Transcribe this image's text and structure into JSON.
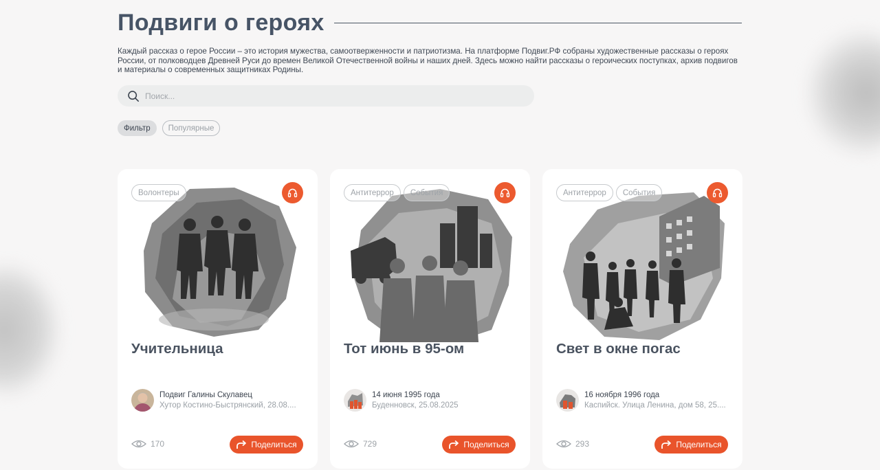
{
  "page": {
    "title": "Подвиги о героях",
    "intro": "Каждый рассказ о герое России – это история мужества, самоотверженности и патриотизма. На платформе Подвиг.РФ собраны художественные рассказы о героях России, от полководцев Древней Руси до времен Великой Отечественной войны и наших дней. Здесь можно найти рассказы о героических поступках, архив подвигов и материалы о современных защитниках Родины."
  },
  "search": {
    "placeholder": "Поиск...",
    "icon": "search-icon"
  },
  "filters": {
    "filter_label": "Фильтр",
    "popular_label": "Популярные"
  },
  "colors": {
    "accent": "#ec5a2f",
    "title": "#475466",
    "background": "#f7f6f6"
  },
  "cards": [
    {
      "tags": [
        "Волонтеры"
      ],
      "title": "Учительница",
      "meta_top": "Подвиг Галины Скулавец",
      "meta_bottom": "Хутор Костино-Быстрянский, 28.08....",
      "views": "170",
      "share_label": "Поделиться",
      "audio_icon": "headphones-icon"
    },
    {
      "tags": [
        "Антитеррор",
        "События"
      ],
      "title": "Тот июнь в 95-ом",
      "meta_top": "14 июня 1995 года",
      "meta_bottom": "Буденновск, 25.08.2025",
      "views": "729",
      "share_label": "Поделиться",
      "audio_icon": "headphones-icon"
    },
    {
      "tags": [
        "Антитеррор",
        "События"
      ],
      "title": "Свет в окне погас",
      "meta_top": "16 ноября 1996 года",
      "meta_bottom": "Каспийск. Улица Ленина, дом 58, 25....",
      "views": "293",
      "share_label": "Поделиться",
      "audio_icon": "headphones-icon"
    }
  ]
}
